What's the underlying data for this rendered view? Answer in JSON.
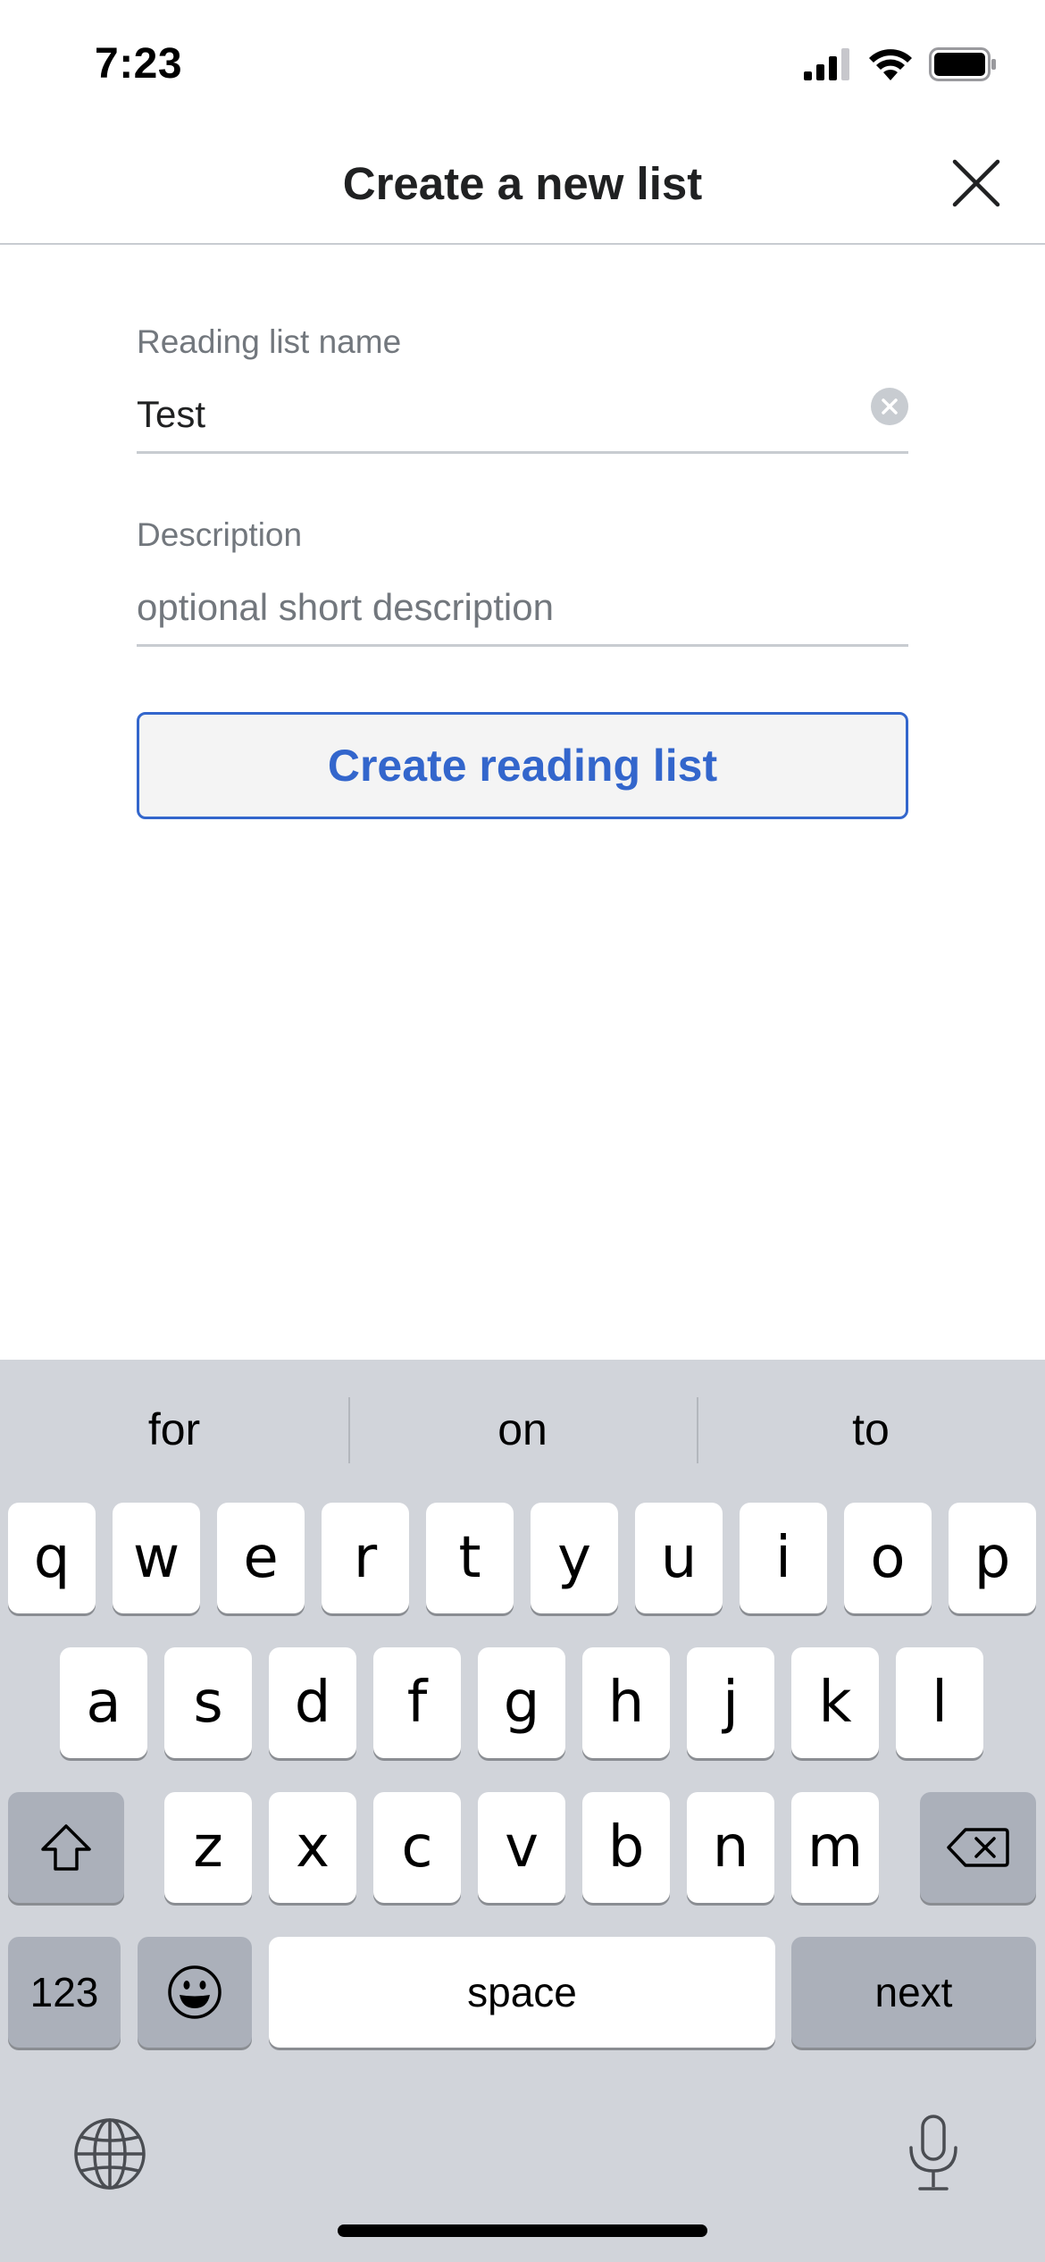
{
  "status_bar": {
    "time": "7:23"
  },
  "header": {
    "title": "Create a new list"
  },
  "form": {
    "name_label": "Reading list name",
    "name_value": "Test",
    "description_label": "Description",
    "description_placeholder": "optional short description",
    "submit_label": "Create reading list"
  },
  "keyboard": {
    "suggestions": [
      "for",
      "on",
      "to"
    ],
    "row1": [
      "q",
      "w",
      "e",
      "r",
      "t",
      "y",
      "u",
      "i",
      "o",
      "p"
    ],
    "row2": [
      "a",
      "s",
      "d",
      "f",
      "g",
      "h",
      "j",
      "k",
      "l"
    ],
    "row3": [
      "z",
      "x",
      "c",
      "v",
      "b",
      "n",
      "m"
    ],
    "numbers_label": "123",
    "space_label": "space",
    "next_label": "next"
  },
  "colors": {
    "accent": "#3366cc",
    "keyboard_bg": "#d1d4da",
    "dark_key": "#abb0ba"
  }
}
